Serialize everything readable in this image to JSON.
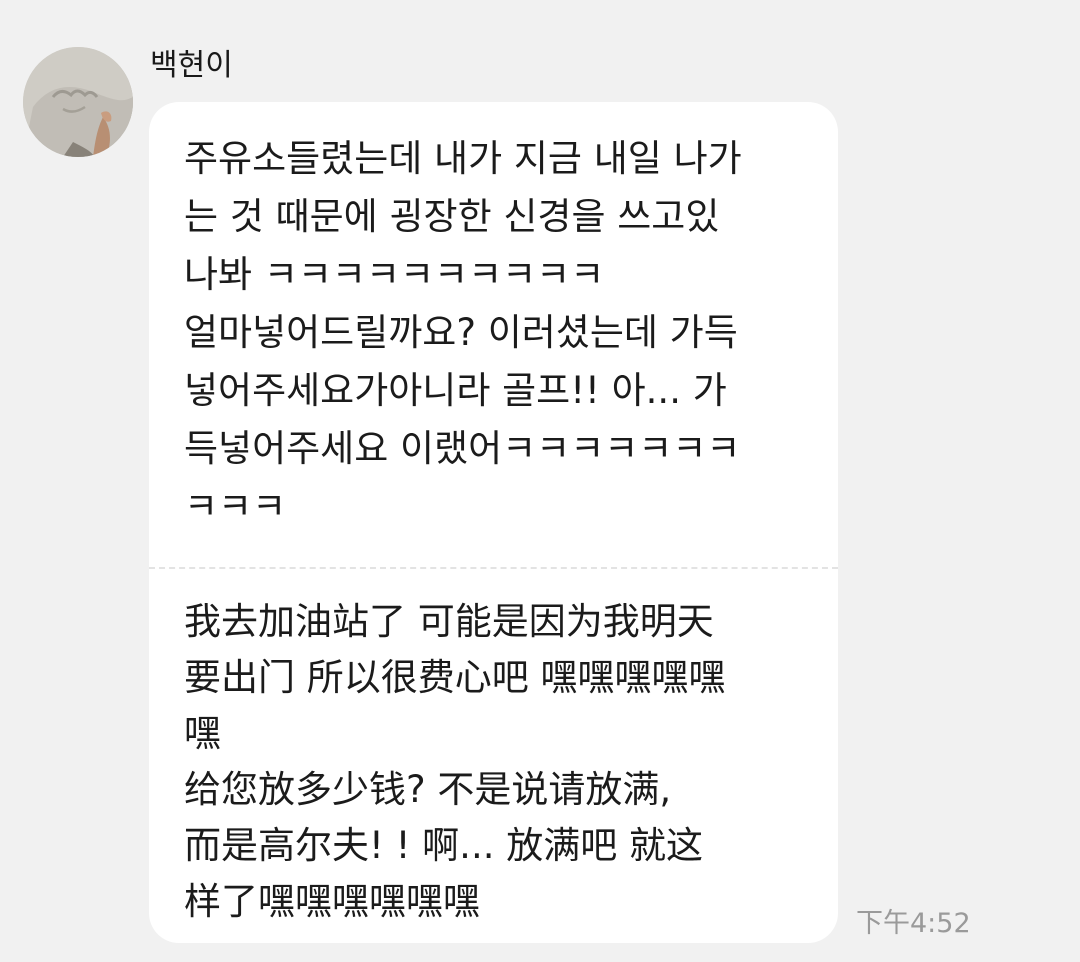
{
  "chat": {
    "sender_name": "백현이",
    "avatar_icon": "profile-photo-avatar",
    "message": {
      "original_lines": [
        "주유소들렸는데 내가 지금 내일 나가",
        "는 것 때문에 굉장한 신경을 쓰고있",
        "나봐 ㅋㅋㅋㅋㅋㅋㅋㅋㅋㅋ",
        "얼마넣어드릴까요? 이러셨는데 가득",
        "넣어주세요가아니라 골프!! 아... 가",
        "득넣어주세요 이랬어ㅋㅋㅋㅋㅋㅋㅋ",
        "ㅋㅋㅋ"
      ],
      "translated_lines": [
        "我去加油站了 可能是因为我明天",
        "要出门 所以很费心吧 嘿嘿嘿嘿嘿",
        "嘿",
        "给您放多少钱?   不是说请放满,",
        "而是高尔夫!  !   啊... 放满吧 就这",
        "样了嘿嘿嘿嘿嘿嘿"
      ],
      "timestamp": "下午4:52"
    },
    "colors": {
      "background": "#f1f1f1",
      "bubble": "#ffffff",
      "text": "#1b1b1b",
      "timestamp": "#9a9a9a",
      "divider": "#e3e3e3"
    }
  }
}
